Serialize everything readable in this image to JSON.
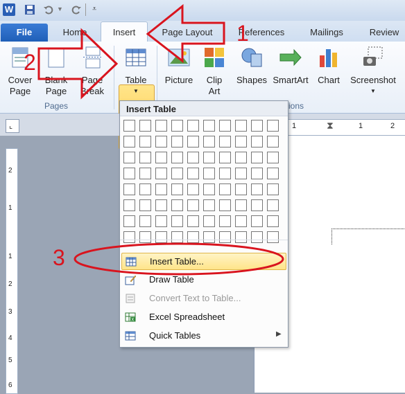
{
  "app": {
    "logo": "W"
  },
  "tabs": [
    "File",
    "Home",
    "Insert",
    "Page Layout",
    "References",
    "Mailings",
    "Review"
  ],
  "ribbon": {
    "cover_page": "Cover\nPage",
    "blank_page": "Blank\nPage",
    "page_break": "Page\nBreak",
    "table": "Table",
    "picture": "Picture",
    "clip_art": "Clip\nArt",
    "shapes": "Shapes",
    "smartart": "SmartArt",
    "chart": "Chart",
    "screenshot": "Screenshot",
    "group_pages": "Pages",
    "group_illustrations_partial": "ions"
  },
  "dropdown": {
    "header": "Insert Table",
    "grid_cols": 10,
    "grid_rows": 8,
    "items": [
      {
        "label": "Insert Table...",
        "highlighted": true,
        "disabled": false
      },
      {
        "label": "Draw Table",
        "highlighted": false,
        "disabled": false
      },
      {
        "label": "Convert Text to Table...",
        "highlighted": false,
        "disabled": true
      },
      {
        "label": "Excel Spreadsheet",
        "highlighted": false,
        "disabled": false
      },
      {
        "label": "Quick Tables",
        "highlighted": false,
        "disabled": false,
        "submenu": true
      }
    ]
  },
  "ruler": {
    "top_marks": [
      "1",
      "1",
      "2"
    ],
    "left_marks": [
      "2",
      "1",
      "1",
      "2",
      "3",
      "4",
      "5",
      "6"
    ]
  },
  "annotations": [
    "1",
    "2",
    "3"
  ],
  "colors": {
    "annotation": "#d9141e",
    "accent": "#2a5fb5",
    "highlight": "#ffe48a"
  }
}
